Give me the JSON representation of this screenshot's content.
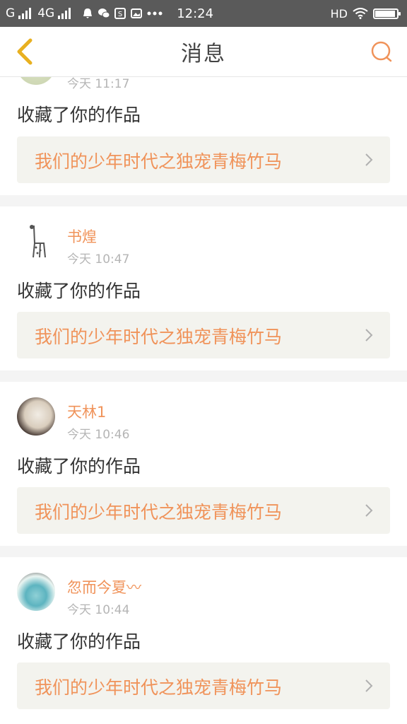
{
  "status_bar": {
    "carrier1": "G",
    "carrier2": "4G",
    "time": "12:24",
    "hd": "HD",
    "icons": [
      "signal-icon",
      "signal-icon",
      "notification-icon",
      "wechat-icon",
      "s-app-icon",
      "gallery-icon",
      "more-dots-icon",
      "wifi-icon",
      "battery-icon"
    ],
    "battery_level": 0.95
  },
  "header": {
    "title": "消息",
    "back_icon": "chevron-left-icon",
    "search_icon": "search-icon",
    "accent_color": "#f0935a",
    "back_color": "#e8b020"
  },
  "messages": [
    {
      "user": "",
      "time": "今天 11:17",
      "action": "收藏了你的作品",
      "work": "我们的少年时代之独宠青梅竹马"
    },
    {
      "user": "书煌",
      "time": "今天 10:47",
      "action": "收藏了你的作品",
      "work": "我们的少年时代之独宠青梅竹马"
    },
    {
      "user": "天林1",
      "time": "今天 10:46",
      "action": "收藏了你的作品",
      "work": "我们的少年时代之独宠青梅竹马"
    },
    {
      "user": "忽而今夏〰",
      "time": "今天 10:44",
      "action": "收藏了你的作品",
      "work": "我们的少年时代之独宠青梅竹马"
    }
  ]
}
